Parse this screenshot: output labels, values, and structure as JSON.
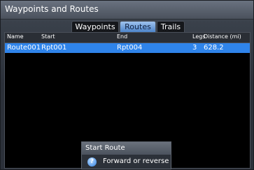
{
  "window": {
    "title": "Waypoints and Routes"
  },
  "tabs": [
    {
      "label": "Waypoints",
      "active": false
    },
    {
      "label": "Routes",
      "active": true
    },
    {
      "label": "Trails",
      "active": false
    }
  ],
  "table": {
    "columns": [
      "Name",
      "Start",
      "End",
      "Legs",
      "Distance (mi)"
    ],
    "rows": [
      {
        "name": "Route001",
        "start": "Rpt001",
        "end": "Rpt004",
        "legs": "3",
        "distance": "628.2",
        "selected": true
      }
    ]
  },
  "popup": {
    "title": "Start Route",
    "item": {
      "icon": "question-icon",
      "label": "Forward or reverse"
    }
  },
  "colors": {
    "selected_row": "#2f84ea",
    "active_tab": "#4d84c9",
    "background": "#000000"
  }
}
